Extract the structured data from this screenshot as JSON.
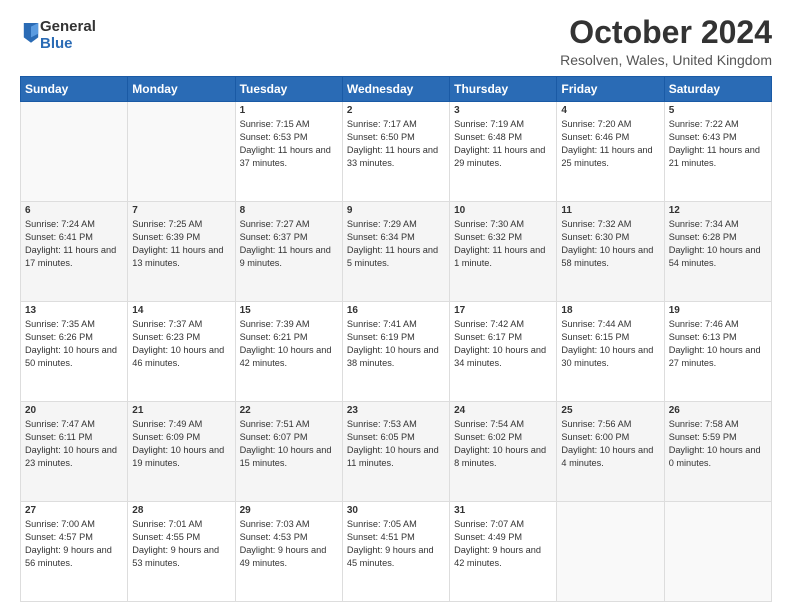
{
  "logo": {
    "general": "General",
    "blue": "Blue"
  },
  "header": {
    "month": "October 2024",
    "location": "Resolven, Wales, United Kingdom"
  },
  "weekdays": [
    "Sunday",
    "Monday",
    "Tuesday",
    "Wednesday",
    "Thursday",
    "Friday",
    "Saturday"
  ],
  "weeks": [
    [
      {
        "day": "",
        "sunrise": "",
        "sunset": "",
        "daylight": ""
      },
      {
        "day": "",
        "sunrise": "",
        "sunset": "",
        "daylight": ""
      },
      {
        "day": "1",
        "sunrise": "Sunrise: 7:15 AM",
        "sunset": "Sunset: 6:53 PM",
        "daylight": "Daylight: 11 hours and 37 minutes."
      },
      {
        "day": "2",
        "sunrise": "Sunrise: 7:17 AM",
        "sunset": "Sunset: 6:50 PM",
        "daylight": "Daylight: 11 hours and 33 minutes."
      },
      {
        "day": "3",
        "sunrise": "Sunrise: 7:19 AM",
        "sunset": "Sunset: 6:48 PM",
        "daylight": "Daylight: 11 hours and 29 minutes."
      },
      {
        "day": "4",
        "sunrise": "Sunrise: 7:20 AM",
        "sunset": "Sunset: 6:46 PM",
        "daylight": "Daylight: 11 hours and 25 minutes."
      },
      {
        "day": "5",
        "sunrise": "Sunrise: 7:22 AM",
        "sunset": "Sunset: 6:43 PM",
        "daylight": "Daylight: 11 hours and 21 minutes."
      }
    ],
    [
      {
        "day": "6",
        "sunrise": "Sunrise: 7:24 AM",
        "sunset": "Sunset: 6:41 PM",
        "daylight": "Daylight: 11 hours and 17 minutes."
      },
      {
        "day": "7",
        "sunrise": "Sunrise: 7:25 AM",
        "sunset": "Sunset: 6:39 PM",
        "daylight": "Daylight: 11 hours and 13 minutes."
      },
      {
        "day": "8",
        "sunrise": "Sunrise: 7:27 AM",
        "sunset": "Sunset: 6:37 PM",
        "daylight": "Daylight: 11 hours and 9 minutes."
      },
      {
        "day": "9",
        "sunrise": "Sunrise: 7:29 AM",
        "sunset": "Sunset: 6:34 PM",
        "daylight": "Daylight: 11 hours and 5 minutes."
      },
      {
        "day": "10",
        "sunrise": "Sunrise: 7:30 AM",
        "sunset": "Sunset: 6:32 PM",
        "daylight": "Daylight: 11 hours and 1 minute."
      },
      {
        "day": "11",
        "sunrise": "Sunrise: 7:32 AM",
        "sunset": "Sunset: 6:30 PM",
        "daylight": "Daylight: 10 hours and 58 minutes."
      },
      {
        "day": "12",
        "sunrise": "Sunrise: 7:34 AM",
        "sunset": "Sunset: 6:28 PM",
        "daylight": "Daylight: 10 hours and 54 minutes."
      }
    ],
    [
      {
        "day": "13",
        "sunrise": "Sunrise: 7:35 AM",
        "sunset": "Sunset: 6:26 PM",
        "daylight": "Daylight: 10 hours and 50 minutes."
      },
      {
        "day": "14",
        "sunrise": "Sunrise: 7:37 AM",
        "sunset": "Sunset: 6:23 PM",
        "daylight": "Daylight: 10 hours and 46 minutes."
      },
      {
        "day": "15",
        "sunrise": "Sunrise: 7:39 AM",
        "sunset": "Sunset: 6:21 PM",
        "daylight": "Daylight: 10 hours and 42 minutes."
      },
      {
        "day": "16",
        "sunrise": "Sunrise: 7:41 AM",
        "sunset": "Sunset: 6:19 PM",
        "daylight": "Daylight: 10 hours and 38 minutes."
      },
      {
        "day": "17",
        "sunrise": "Sunrise: 7:42 AM",
        "sunset": "Sunset: 6:17 PM",
        "daylight": "Daylight: 10 hours and 34 minutes."
      },
      {
        "day": "18",
        "sunrise": "Sunrise: 7:44 AM",
        "sunset": "Sunset: 6:15 PM",
        "daylight": "Daylight: 10 hours and 30 minutes."
      },
      {
        "day": "19",
        "sunrise": "Sunrise: 7:46 AM",
        "sunset": "Sunset: 6:13 PM",
        "daylight": "Daylight: 10 hours and 27 minutes."
      }
    ],
    [
      {
        "day": "20",
        "sunrise": "Sunrise: 7:47 AM",
        "sunset": "Sunset: 6:11 PM",
        "daylight": "Daylight: 10 hours and 23 minutes."
      },
      {
        "day": "21",
        "sunrise": "Sunrise: 7:49 AM",
        "sunset": "Sunset: 6:09 PM",
        "daylight": "Daylight: 10 hours and 19 minutes."
      },
      {
        "day": "22",
        "sunrise": "Sunrise: 7:51 AM",
        "sunset": "Sunset: 6:07 PM",
        "daylight": "Daylight: 10 hours and 15 minutes."
      },
      {
        "day": "23",
        "sunrise": "Sunrise: 7:53 AM",
        "sunset": "Sunset: 6:05 PM",
        "daylight": "Daylight: 10 hours and 11 minutes."
      },
      {
        "day": "24",
        "sunrise": "Sunrise: 7:54 AM",
        "sunset": "Sunset: 6:02 PM",
        "daylight": "Daylight: 10 hours and 8 minutes."
      },
      {
        "day": "25",
        "sunrise": "Sunrise: 7:56 AM",
        "sunset": "Sunset: 6:00 PM",
        "daylight": "Daylight: 10 hours and 4 minutes."
      },
      {
        "day": "26",
        "sunrise": "Sunrise: 7:58 AM",
        "sunset": "Sunset: 5:59 PM",
        "daylight": "Daylight: 10 hours and 0 minutes."
      }
    ],
    [
      {
        "day": "27",
        "sunrise": "Sunrise: 7:00 AM",
        "sunset": "Sunset: 4:57 PM",
        "daylight": "Daylight: 9 hours and 56 minutes."
      },
      {
        "day": "28",
        "sunrise": "Sunrise: 7:01 AM",
        "sunset": "Sunset: 4:55 PM",
        "daylight": "Daylight: 9 hours and 53 minutes."
      },
      {
        "day": "29",
        "sunrise": "Sunrise: 7:03 AM",
        "sunset": "Sunset: 4:53 PM",
        "daylight": "Daylight: 9 hours and 49 minutes."
      },
      {
        "day": "30",
        "sunrise": "Sunrise: 7:05 AM",
        "sunset": "Sunset: 4:51 PM",
        "daylight": "Daylight: 9 hours and 45 minutes."
      },
      {
        "day": "31",
        "sunrise": "Sunrise: 7:07 AM",
        "sunset": "Sunset: 4:49 PM",
        "daylight": "Daylight: 9 hours and 42 minutes."
      },
      {
        "day": "",
        "sunrise": "",
        "sunset": "",
        "daylight": ""
      },
      {
        "day": "",
        "sunrise": "",
        "sunset": "",
        "daylight": ""
      }
    ]
  ]
}
